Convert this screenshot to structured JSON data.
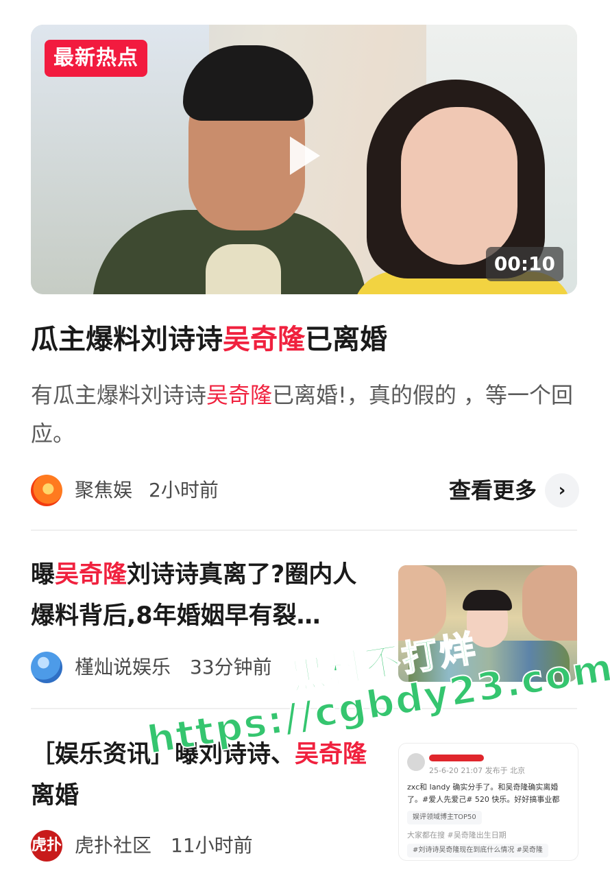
{
  "hero": {
    "badge": "最新热点",
    "duration": "00:10"
  },
  "featured": {
    "title_a": "瓜主爆料刘诗诗",
    "title_red": "吴奇隆",
    "title_b": "已离婚",
    "desc_a": "有瓜主爆料刘诗诗",
    "desc_red": "吴奇隆",
    "desc_b": "已离婚!，真的假的 ，等一个回应。",
    "source": "聚焦娱",
    "time": "2小时前",
    "more_label": "查看更多",
    "more_icon": "›"
  },
  "items": [
    {
      "title_a": "曝",
      "title_red": "吴奇隆",
      "title_b": "刘诗诗真离了?圈内人爆料背后,8年婚姻早有裂…",
      "source": "槿灿说娱乐",
      "time": "33分钟前"
    },
    {
      "title_a": "［娱乐资讯］曝刘诗诗、",
      "title_red": "吴奇隆",
      "title_b": "离婚",
      "source": "虎扑社区",
      "time": "11小时前",
      "source_icon_text": "虎扑"
    }
  ],
  "thumb2": {
    "meta": "25-6-20 21:07  发布于 北京",
    "line1": "zxc和 landy 确实分手了。和吴奇隆确实离婚",
    "line2": "了。#爱人先爱己# 520 快乐。好好搞事业都",
    "chip1": "娱评领域博主TOP50",
    "line3": "大家都在搜   #吴奇隆出生日期",
    "chip2": "#刘诗诗吴奇隆现在到底什么情况   #吴奇隆"
  },
  "watermark": {
    "line1": "黑料不打烊",
    "line2": "https://cgbdy23.com"
  }
}
